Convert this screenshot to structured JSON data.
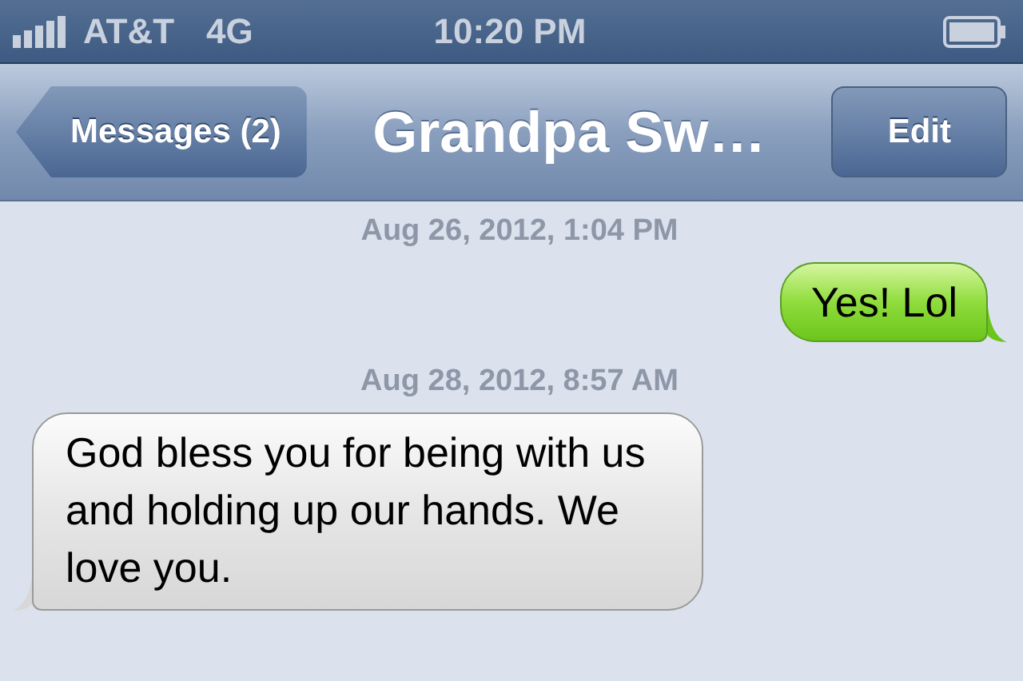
{
  "status_bar": {
    "carrier": "AT&T",
    "network": "4G",
    "time": "10:20 PM"
  },
  "nav_bar": {
    "back_button": "Messages (2)",
    "title": "Grandpa Sw…",
    "edit_button": "Edit"
  },
  "conversation": [
    {
      "kind": "timestamp",
      "text": "Aug 26, 2012, 1:04 PM"
    },
    {
      "kind": "sent",
      "text": "Yes! Lol"
    },
    {
      "kind": "timestamp",
      "text": "Aug 28, 2012, 8:57 AM"
    },
    {
      "kind": "received",
      "text": "God bless you for being with us and holding up our hands. We love you."
    }
  ]
}
